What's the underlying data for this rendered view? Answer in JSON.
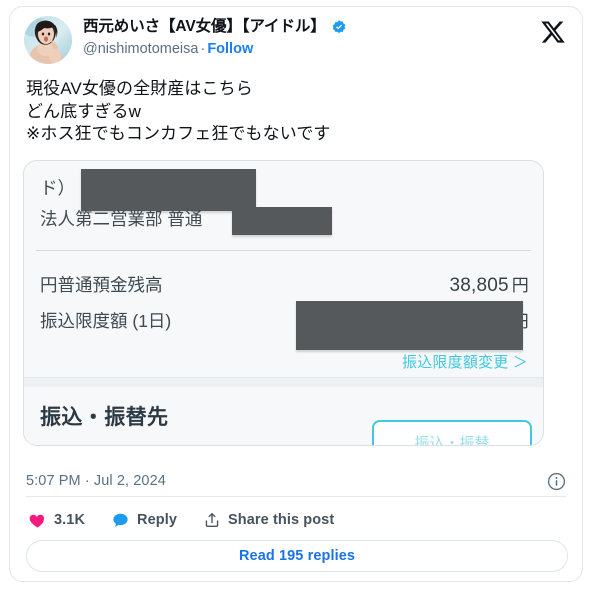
{
  "post": {
    "author": {
      "display_name": "西元めいさ【AV女優】【アイドル】",
      "handle": "@nishimotomeisa",
      "separator": "·",
      "follow_label": "Follow",
      "verified_icon": "verified-badge-icon",
      "avatar_icon": "avatar-photo"
    },
    "brand_icon": "x-logo-icon",
    "text": "現役AV女優の全財産はこちら\nどん底すぎるw\n※ホス狂でもコンカフェ狂でもないです",
    "timestamp": "5:07 PM · Jul 2, 2024",
    "info_icon": "info-circle-icon",
    "actions": {
      "like": {
        "icon": "heart-icon",
        "label": "3.1K",
        "color": "#f91880"
      },
      "reply": {
        "icon": "speech-bubble-icon",
        "label": "Reply",
        "color": "#1d9bf0"
      },
      "share": {
        "icon": "share-upload-icon",
        "label": "Share this post"
      }
    },
    "read_replies_label": "Read 195 replies"
  },
  "media": {
    "type": "bank-account-screenshot",
    "account_line_1": "ド）",
    "account_line_2": "法人第二営業部 普通",
    "rows": [
      {
        "label": "円普通預金残高",
        "value": "38,805",
        "unit": "円"
      },
      {
        "label": "振込限度額 (1日)",
        "value": "",
        "unit": "円"
      }
    ],
    "limit_change_link": "振込限度額変更 ＞",
    "section_title": "振込・振替先",
    "cta_label": "振込・振替",
    "redactions": 3
  },
  "colors": {
    "accent_blue": "#1a73e8",
    "follow_blue": "#1b7ff1",
    "verified_blue": "#1d9bf0",
    "like_pink": "#f91880",
    "bank_teal": "#3fc8e0",
    "redaction_gray": "#56595c",
    "text_primary": "#0f1419",
    "text_muted": "#5b7083"
  }
}
